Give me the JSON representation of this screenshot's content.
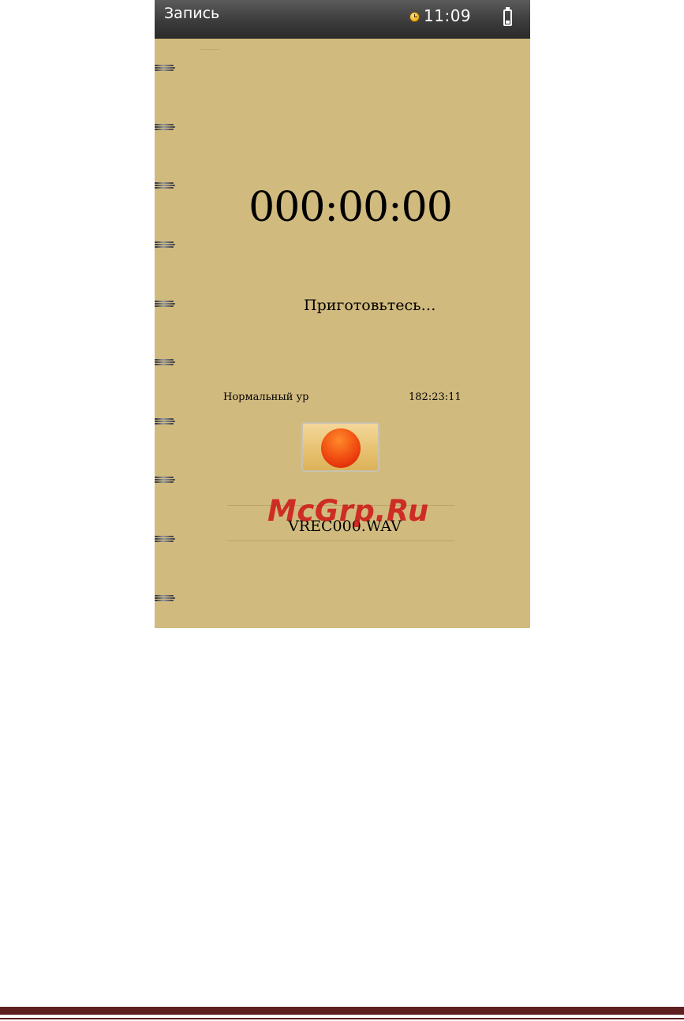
{
  "statusbar": {
    "title": "Запись",
    "time": "11:09",
    "clock_icon": "clock-icon",
    "battery_icon": "battery-icon"
  },
  "recorder": {
    "timer": "000:00:00",
    "status_message": "Приготовьтесь…",
    "quality_label": "Нормальный ур",
    "remaining_time": "182:23:11",
    "record_icon": "record-icon",
    "filename": "VREC000.WAV"
  },
  "watermark": {
    "text": "McGrp.Ru"
  },
  "colors": {
    "background": "#d1ba7e",
    "statusbar": "#3c3c3c",
    "record": "#f04a10",
    "footer": "#5e1f20"
  }
}
